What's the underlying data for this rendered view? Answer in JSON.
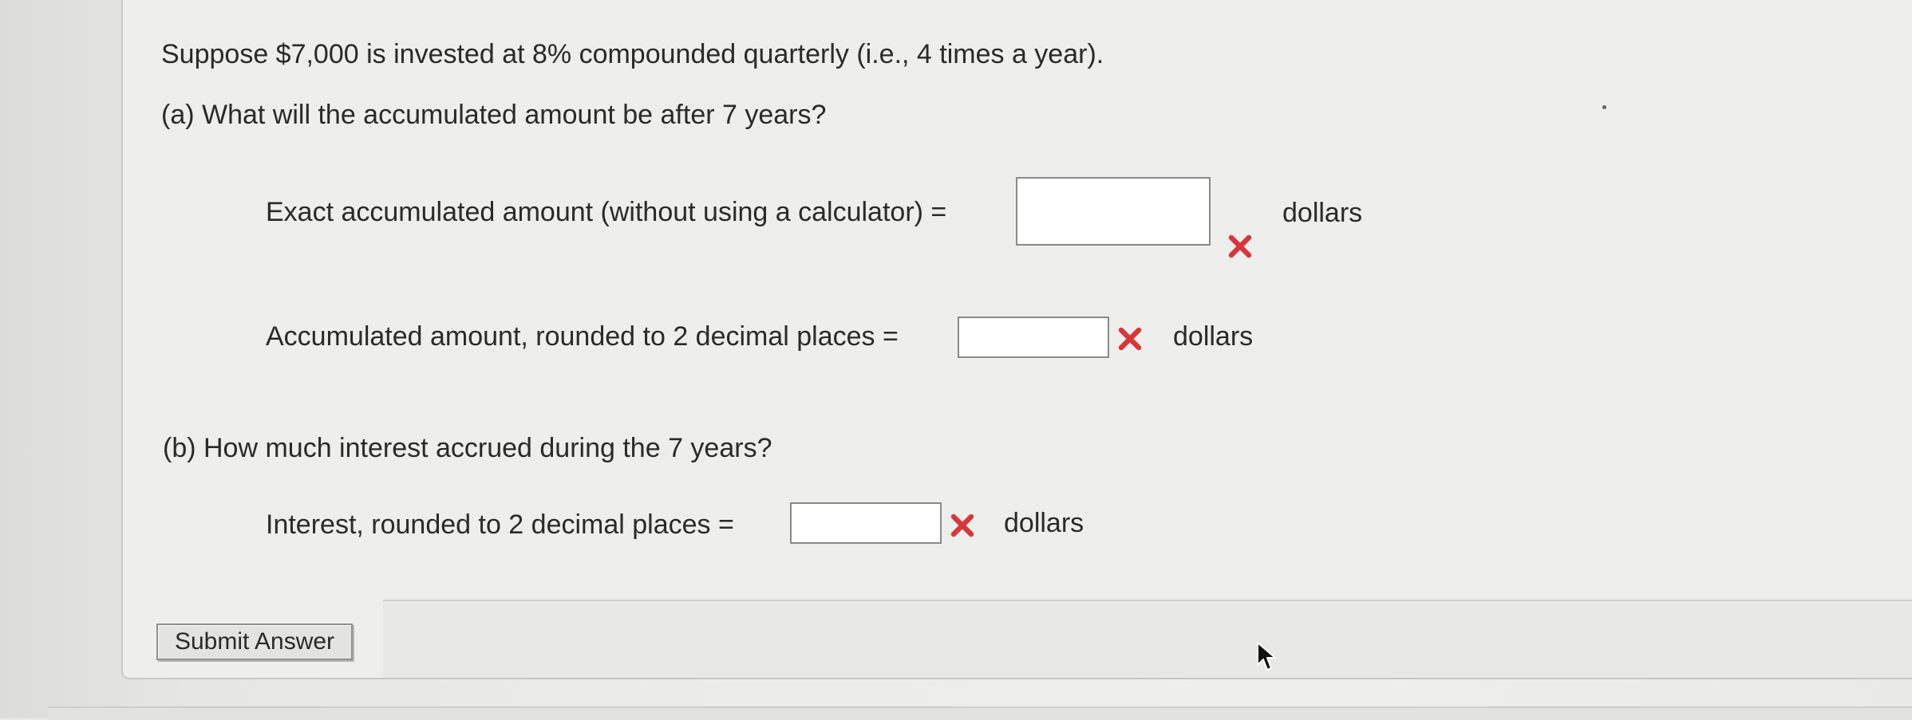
{
  "question": {
    "prompt": "Suppose $7,000 is invested at 8% compounded quarterly (i.e., 4 times a year).",
    "part_a": {
      "heading": "(a) What will the accumulated amount be after 7 years?",
      "exact_label": "Exact accumulated amount (without using a calculator) =",
      "exact_value": "",
      "exact_unit": "dollars",
      "rounded_label": "Accumulated amount, rounded to 2 decimal places =",
      "rounded_value": "",
      "rounded_unit": "dollars"
    },
    "part_b": {
      "heading": "(b) How much interest accrued during the 7 years?",
      "interest_label": "Interest, rounded to 2 decimal places =",
      "interest_value": "",
      "interest_unit": "dollars"
    },
    "status_icon": "incorrect-x-icon",
    "status_color": "#d6373b"
  },
  "actions": {
    "submit_label": "Submit Answer"
  }
}
